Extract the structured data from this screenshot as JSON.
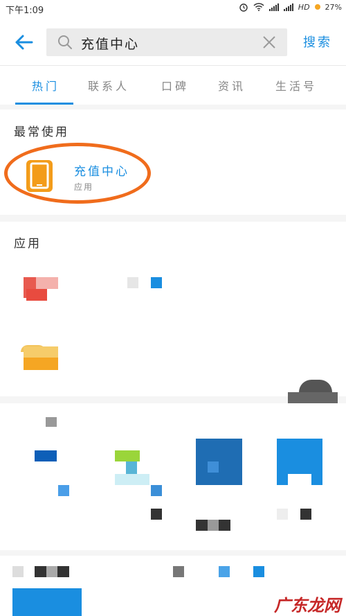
{
  "status_bar": {
    "time": "下午1:09",
    "network": "HD",
    "battery": "27%"
  },
  "search": {
    "query": "充值中心",
    "button": "搜索"
  },
  "tabs": [
    {
      "label": "热门",
      "active": true
    },
    {
      "label": "联系人",
      "active": false
    },
    {
      "label": "口碑",
      "active": false
    },
    {
      "label": "资讯",
      "active": false
    },
    {
      "label": "生活号",
      "active": false
    }
  ],
  "recent": {
    "title": "最常使用",
    "item": {
      "name": "充值中心",
      "type": "应用"
    }
  },
  "apps_section": {
    "title": "应用"
  },
  "watermark": "广东龙网",
  "colors": {
    "accent": "#1a8ee0",
    "highlight_circle": "#f06c1c",
    "app_icon": "#f39c1a"
  }
}
